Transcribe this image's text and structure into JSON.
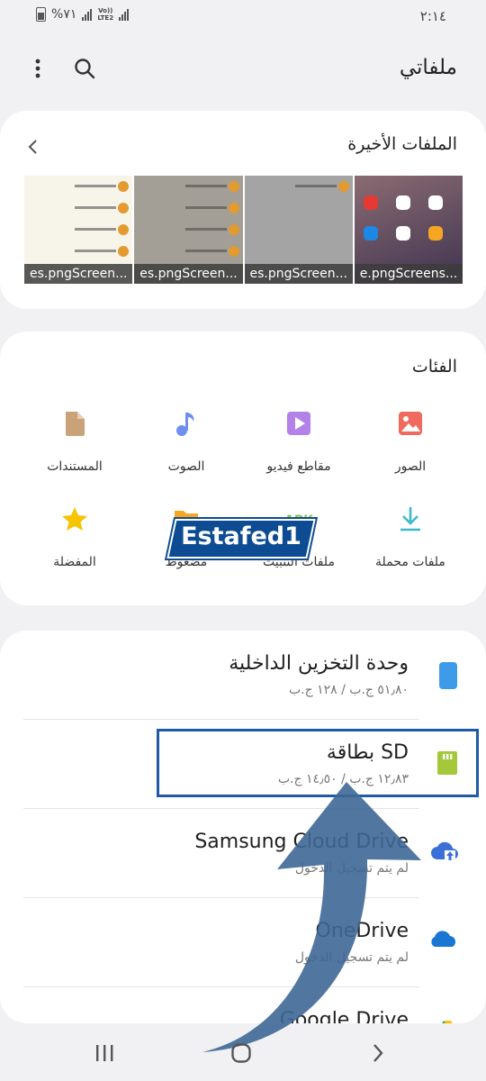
{
  "status_bar": {
    "time": "٢:١٤",
    "battery": "%٧١",
    "network": "LTE2",
    "volte": "Vo))"
  },
  "app": {
    "title": "ملفاتي",
    "search_icon": "search-icon",
    "more_icon": "more-vert-icon"
  },
  "recent": {
    "title": "الملفات الأخيرة",
    "thumbnails": [
      {
        "caption": "e.pngScreens..."
      },
      {
        "caption": "es.pngScreen..."
      },
      {
        "caption": "es.pngScreen..."
      },
      {
        "caption": "es.pngScreen..."
      }
    ]
  },
  "categories": {
    "title": "الفئات",
    "items": [
      {
        "label": "الصور",
        "icon": "images-icon",
        "color": "#f06a5e"
      },
      {
        "label": "مقاطع فيديو",
        "icon": "video-icon",
        "color": "#b481e8"
      },
      {
        "label": "الصوت",
        "icon": "audio-icon",
        "color": "#6f8ef0"
      },
      {
        "label": "المستندات",
        "icon": "document-icon",
        "color": "#c9a27a"
      },
      {
        "label": "ملفات محملة",
        "icon": "download-icon",
        "color": "#3fb9c9"
      },
      {
        "label": "ملفات التثبيت",
        "icon": "apk-icon",
        "color": "#8bc34a"
      },
      {
        "label": "مضغوط",
        "icon": "zip-folder-icon",
        "color": "#f6a623"
      },
      {
        "label": "المفضلة",
        "icon": "star-icon",
        "color": "#f6c400"
      }
    ]
  },
  "storage": {
    "items": [
      {
        "title": "وحدة التخزين الداخلية",
        "subtitle": "٥١٫٨٠ ج.ب / ١٢٨ ج.ب",
        "icon": "phone-storage-icon",
        "color": "#3d9be9"
      },
      {
        "title": "بطاقة SD",
        "subtitle": "١٢٫٨٣ ج.ب / ١٤٫٥٠ ج.ب",
        "icon": "sd-card-icon",
        "color": "#a3c93a"
      },
      {
        "title": "Samsung Cloud Drive",
        "subtitle": "لم يتم تسجيل الدخول",
        "icon": "cloud-upload-icon",
        "color": "#3b6fd8"
      },
      {
        "title": "OneDrive",
        "subtitle": "لم يتم تسجيل الدخول",
        "icon": "onedrive-icon",
        "color": "#1976d2"
      },
      {
        "title": "Google Drive",
        "subtitle": "",
        "icon": "google-drive-icon",
        "color": "#1fa463"
      }
    ]
  },
  "watermark": {
    "text": "Estafed1"
  },
  "navbar": {
    "back": "back-icon",
    "home": "home-icon",
    "recents": "recents-icon"
  }
}
